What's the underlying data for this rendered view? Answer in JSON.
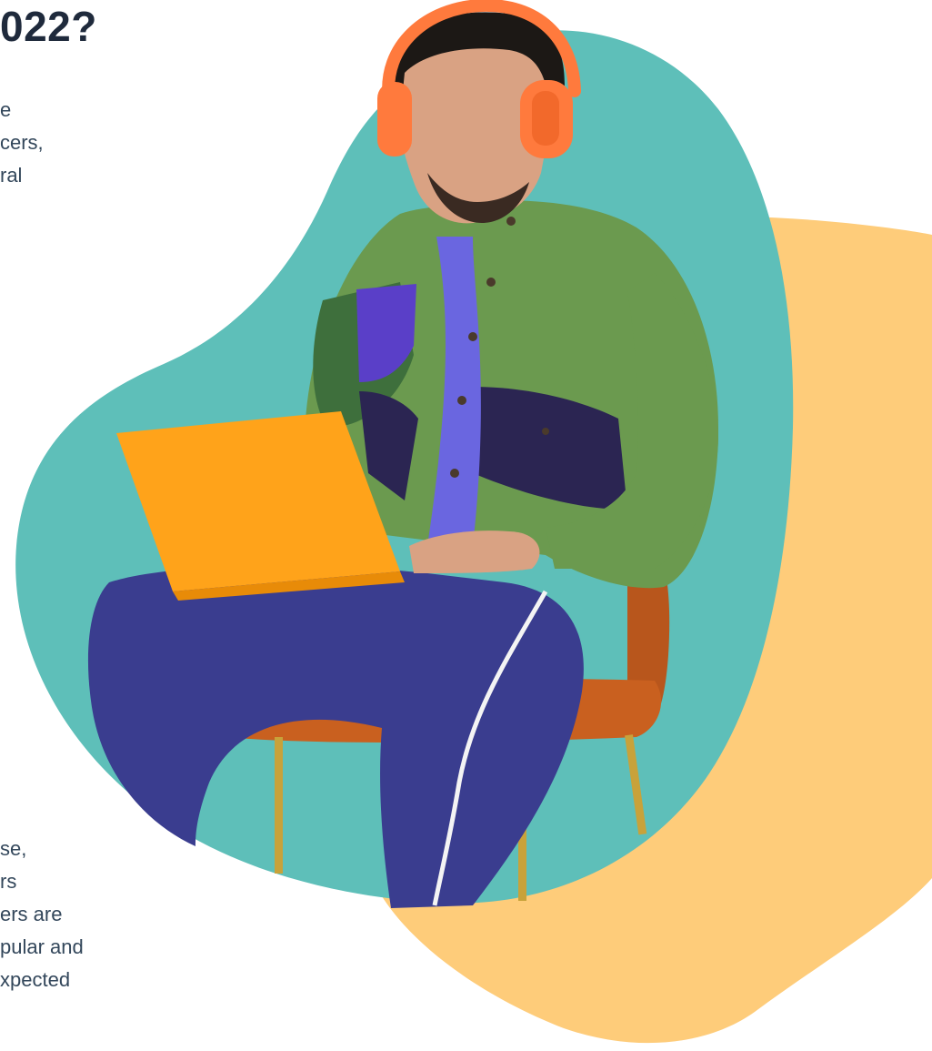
{
  "headline": "022?",
  "intro_lines": [
    "e",
    "cers,",
    "ral"
  ],
  "body_lines": [
    "se,",
    "rs",
    "ers are",
    "pular and",
    "xpected"
  ],
  "colors": {
    "heading": "#1f2a3c",
    "text": "#33475b",
    "teal_blob": "#5ebfb9",
    "orange_blob": "#fecc7a",
    "laptop": "#ffa31a",
    "headphones": "#ff7a3d",
    "jacket": "#6b9a4f",
    "pants": "#3a3d8f",
    "chair": "#c9601f"
  },
  "hero": {
    "subject_icon": "person-with-headphones-and-laptop-icon"
  }
}
